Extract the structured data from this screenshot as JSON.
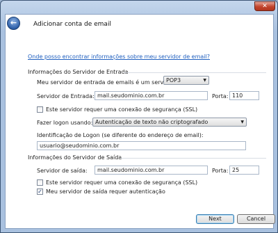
{
  "window": {
    "title": "Adicionar conta de email",
    "close_glyph": "✕",
    "back_glyph": "←"
  },
  "link": "Onde posso encontrar informações sobre meu servidor de email?",
  "incoming": {
    "section_title": "Informações do Servidor de Entrada",
    "type_label": "Meu servidor de entrada de emails é um servidor",
    "type_value": "POP3",
    "server_label": "Servidor de Entrada:",
    "server_value": "mail.seudominio.com.br",
    "port_label": "Porta:",
    "port_value": "110",
    "ssl_label": "Este servidor requer uma conexão de segurança (SSL)",
    "ssl_checked": false,
    "logon_label": "Fazer logon usando:",
    "logon_value": "Autenticação de texto não criptografado",
    "logon_id_label": "Identificação de Logon (se diferente do endereço de email):",
    "logon_id_value": "usuario@seudominio.com.br"
  },
  "outgoing": {
    "section_title": "Informações do Servidor de Saída",
    "server_label": "Servidor de saída:",
    "server_value": "mail.seudominio.com.br",
    "port_label": "Porta:",
    "port_value": "25",
    "ssl_label": "Este servidor requer uma conexão de segurança (SSL)",
    "ssl_checked": false,
    "auth_label": "Meu servidor de saída requer autenticação",
    "auth_checked": true
  },
  "buttons": {
    "next": "Next",
    "cancel": "Cancel"
  }
}
